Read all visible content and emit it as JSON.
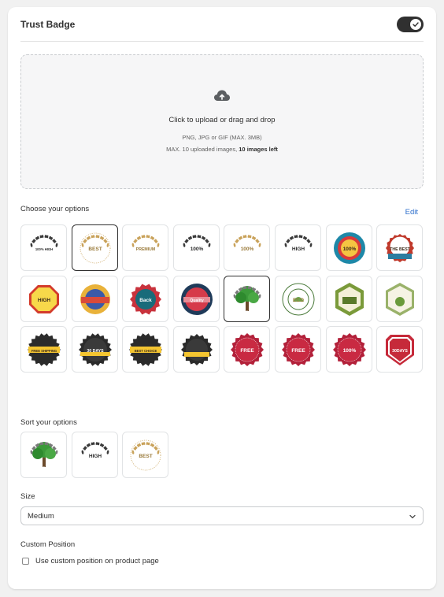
{
  "card": {
    "title": "Trust Badge",
    "toggle_on": true
  },
  "upload": {
    "icon": "cloud-upload-icon",
    "main_text": "Click to upload or drag and drop",
    "formats": "PNG, JPG or GIF (MAX. 3MB)",
    "limit_prefix": "MAX. 10 uploaded images,",
    "limit_left": "10 images left"
  },
  "options": {
    "label": "Choose your options",
    "edit_label": "Edit",
    "badges": [
      {
        "name": "badge-100-high-quality-wreath",
        "text": "100% HIGH",
        "style": "laurel-dark",
        "selected": false
      },
      {
        "name": "badge-premium-quality-best-choice",
        "text": "BEST",
        "style": "laurel-gold-text",
        "selected": true
      },
      {
        "name": "badge-premium-quality-wreath",
        "text": "PREMIUM",
        "style": "laurel-gold-plain",
        "selected": false
      },
      {
        "name": "badge-100-quality-wreath",
        "text": "100%",
        "style": "laurel-dark",
        "selected": false
      },
      {
        "name": "badge-100-premium-quality",
        "text": "100%",
        "style": "laurel-gold-plain",
        "selected": false
      },
      {
        "name": "badge-high-quality-dark",
        "text": "HIGH",
        "style": "laurel-dark",
        "selected": false
      },
      {
        "name": "badge-quality-100",
        "text": "100%",
        "style": "round-blue-red",
        "selected": false
      },
      {
        "name": "badge-quality-guaranteed",
        "text": "THE BEST",
        "style": "seal-red",
        "selected": false
      },
      {
        "name": "badge-high-quality-octagon",
        "text": "HIGH",
        "style": "octagon-yellow",
        "selected": false
      },
      {
        "name": "badge-guaranteed-satisfaction",
        "text": "",
        "style": "round-orange-blue",
        "selected": false
      },
      {
        "name": "badge-money-back",
        "text": "Back",
        "style": "seal-red-teal",
        "selected": false
      },
      {
        "name": "badge-premium-quality-round",
        "text": "Quality",
        "style": "round-red-navy",
        "selected": false
      },
      {
        "name": "badge-eco-tree",
        "text": "ECO",
        "style": "tree",
        "selected": true
      },
      {
        "name": "badge-natural-products-eco",
        "text": "ECO",
        "style": "round-green-outline",
        "selected": false
      },
      {
        "name": "badge-farm-hexagon",
        "text": "",
        "style": "hex-green",
        "selected": false
      },
      {
        "name": "badge-natural-products-hexagon",
        "text": "",
        "style": "hex-light",
        "selected": false
      },
      {
        "name": "badge-free-shipping",
        "text": "FREE SHIPPING",
        "style": "gear-yellow",
        "selected": false
      },
      {
        "name": "badge-30-days",
        "text": "30 DAYS",
        "style": "gear-dark",
        "selected": false
      },
      {
        "name": "badge-best-choice",
        "text": "BEST CHOICE",
        "style": "gear-yellow",
        "selected": false
      },
      {
        "name": "badge-free-return",
        "text": "",
        "style": "gear-dark-ribbon",
        "selected": false
      },
      {
        "name": "badge-free-guarantee",
        "text": "FREE",
        "style": "seal-crimson",
        "selected": false
      },
      {
        "name": "badge-free-return-guarantee",
        "text": "FREE",
        "style": "seal-crimson",
        "selected": false
      },
      {
        "name": "badge-100-money-back",
        "text": "100%",
        "style": "seal-crimson",
        "selected": false
      },
      {
        "name": "badge-30-days-money-back",
        "text": "30DAYS",
        "style": "shield-red",
        "selected": false
      }
    ]
  },
  "sort": {
    "label": "Sort your options",
    "badges": [
      {
        "name": "sort-badge-eco-tree",
        "text": "ECO",
        "style": "tree"
      },
      {
        "name": "sort-badge-100-high-quality",
        "text": "HIGH",
        "style": "laurel-dark"
      },
      {
        "name": "sort-badge-best-choice",
        "text": "BEST",
        "style": "laurel-gold-text"
      }
    ]
  },
  "size": {
    "label": "Size",
    "selected": "Medium"
  },
  "position": {
    "label": "Custom Position",
    "checkbox_label": "Use custom position on product page",
    "checked": false
  }
}
